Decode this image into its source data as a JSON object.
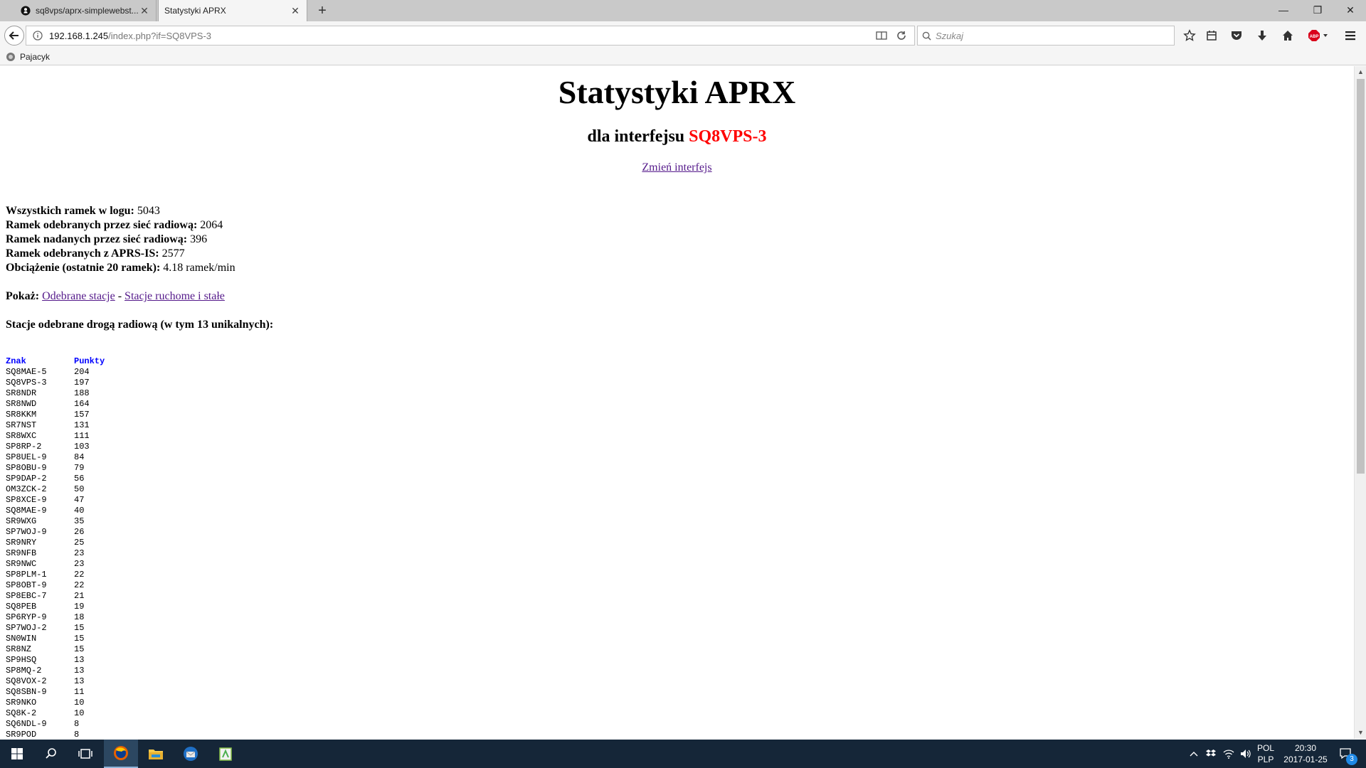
{
  "browser": {
    "tabs": [
      {
        "label": "sq8vps/aprx-simplewebst...",
        "icon": "github-icon"
      },
      {
        "label": "Statystyki APRX",
        "icon": "none"
      }
    ],
    "url": {
      "host": "192.168.1.245",
      "path": "/index.php?if=SQ8VPS-3"
    },
    "search_placeholder": "Szukaj",
    "bookmarks": [
      {
        "label": "Pajacyk",
        "icon": "bookmark-favicon"
      }
    ]
  },
  "page": {
    "title": "Statystyki APRX",
    "subtitle_prefix": "dla interfejsu",
    "interface": "SQ8VPS-3",
    "change_link": "Zmień interfejs",
    "stats": [
      {
        "label": "Wszystkich ramek w logu:",
        "value": "5043"
      },
      {
        "label": "Ramek odebranych przez sieć radiową:",
        "value": "2064"
      },
      {
        "label": "Ramek nadanych przez sieć radiową:",
        "value": "396"
      },
      {
        "label": "Ramek odebranych z APRS-IS:",
        "value": "2577"
      },
      {
        "label": "Obciążenie (ostatnie 20 ramek):",
        "value": "4.18 ramek/min"
      }
    ],
    "show_label": "Pokaż:",
    "show_links": [
      "Odebrane stacje",
      "Stacje ruchome i stałe"
    ],
    "show_separator": "-",
    "heard_heading": "Stacje odebrane drogą radiową (w tym 13 unikalnych):",
    "table_headers": [
      "Znak",
      "Punkty"
    ],
    "stations": [
      [
        "SQ8MAE-5",
        "204"
      ],
      [
        "SQ8VPS-3",
        "197"
      ],
      [
        "SR8NDR",
        "188"
      ],
      [
        "SR8NWD",
        "164"
      ],
      [
        "SR8KKM",
        "157"
      ],
      [
        "SR7NST",
        "131"
      ],
      [
        "SR8WXC",
        "111"
      ],
      [
        "SP8RP-2",
        "103"
      ],
      [
        "SP8UEL-9",
        "84"
      ],
      [
        "SP8OBU-9",
        "79"
      ],
      [
        "SP9DAP-2",
        "56"
      ],
      [
        "OM3ZCK-2",
        "50"
      ],
      [
        "SP8XCE-9",
        "47"
      ],
      [
        "SQ8MAE-9",
        "40"
      ],
      [
        "SR9WXG",
        "35"
      ],
      [
        "SP7WOJ-9",
        "26"
      ],
      [
        "SR9NRY",
        "25"
      ],
      [
        "SR9NFB",
        "23"
      ],
      [
        "SR9NWC",
        "23"
      ],
      [
        "SP8PLM-1",
        "22"
      ],
      [
        "SP8OBT-9",
        "22"
      ],
      [
        "SP8EBC-7",
        "21"
      ],
      [
        "SQ8PEB",
        "19"
      ],
      [
        "SP6RYP-9",
        "18"
      ],
      [
        "SP7WOJ-2",
        "15"
      ],
      [
        "SN0WIN",
        "15"
      ],
      [
        "SR8NZ",
        "15"
      ],
      [
        "SP9HSQ",
        "13"
      ],
      [
        "SP8MQ-2",
        "13"
      ],
      [
        "SQ8VOX-2",
        "13"
      ],
      [
        "SQ8SBN-9",
        "11"
      ],
      [
        "SR9NKO",
        "10"
      ],
      [
        "SQ8K-2",
        "10"
      ],
      [
        "SQ6NDL-9",
        "8"
      ],
      [
        "SR9POD",
        "8"
      ]
    ]
  },
  "taskbar": {
    "apps": [
      "windows-start-icon",
      "search-icon",
      "task-view-icon",
      "firefox-icon",
      "file-explorer-icon",
      "thunderbird-icon",
      "notepad-plus-plus-icon"
    ],
    "lang_top": "POL",
    "lang_bottom": "PLP",
    "time": "20:30",
    "date": "2017-01-25",
    "notification_count": "3"
  },
  "colors": {
    "interface": "#ff0000",
    "link": "#551a8b",
    "table_header": "#0000ff",
    "taskbar": "#152638"
  }
}
